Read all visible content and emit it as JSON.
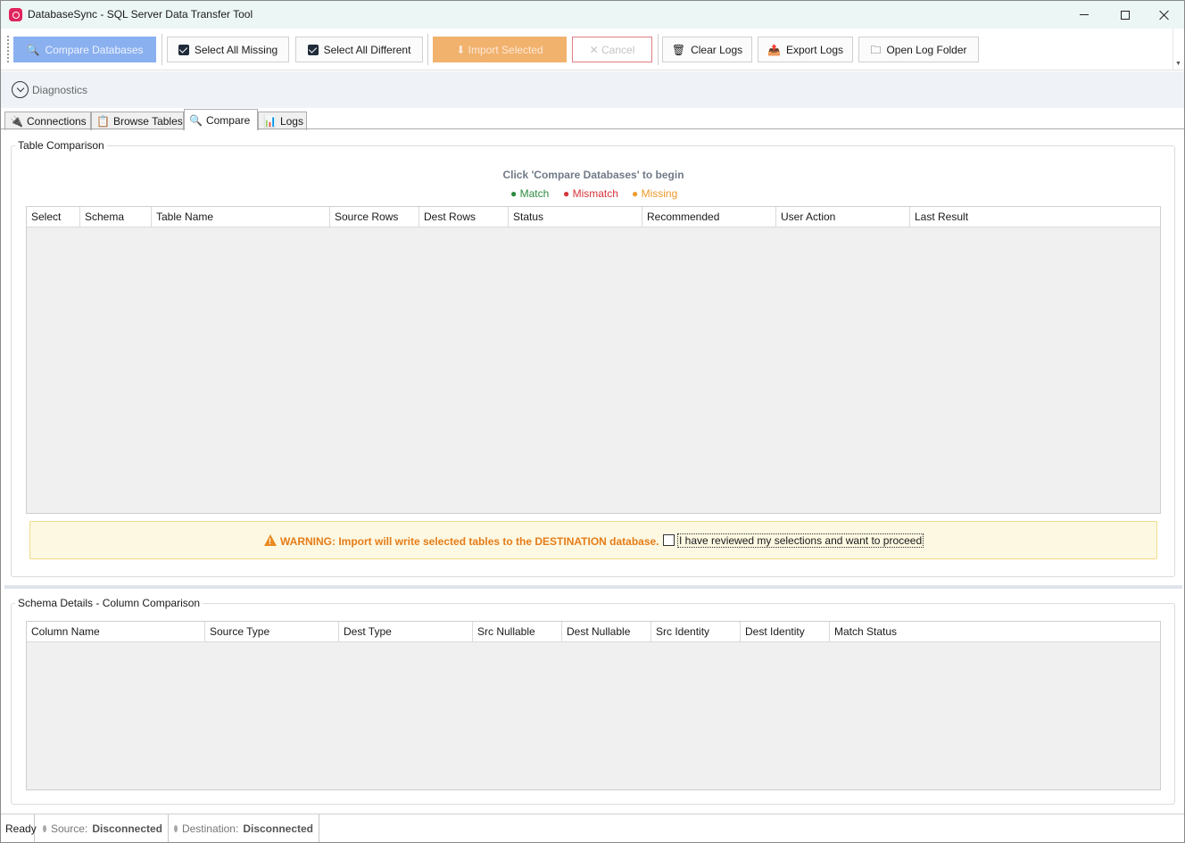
{
  "window": {
    "title": "DatabaseSync - SQL Server Data Transfer Tool"
  },
  "toolbar": {
    "compare_label": "Compare Databases",
    "select_missing_label": "Select All Missing",
    "select_different_label": "Select All Different",
    "import_label": "⬇ Import Selected",
    "cancel_label": "✕ Cancel",
    "clear_logs_label": "Clear Logs",
    "export_logs_label": "Export Logs",
    "open_log_folder_label": "Open Log Folder"
  },
  "diagnostics": {
    "label": "Diagnostics"
  },
  "tabs": [
    {
      "label": "Connections",
      "icon": "plug-icon"
    },
    {
      "label": "Browse Tables",
      "icon": "table-icon"
    },
    {
      "label": "Compare",
      "icon": "magnifier-icon",
      "active": true
    },
    {
      "label": "Logs",
      "icon": "chart-icon"
    }
  ],
  "table_comparison": {
    "title": "Table Comparison",
    "hint": "Click 'Compare Databases' to begin",
    "legend": {
      "match": "● Match",
      "mismatch": "● Mismatch",
      "missing": "● Missing"
    },
    "legend_colors": {
      "match": "#2e8b3e",
      "mismatch": "#d6343b",
      "missing": "#ee9a2c"
    },
    "columns": [
      "Select",
      "Schema",
      "Table Name",
      "Source Rows",
      "Dest Rows",
      "Status",
      "Recommended",
      "User Action",
      "Last Result"
    ],
    "rows": []
  },
  "warning": {
    "text": "WARNING: Import will write selected tables to the DESTINATION database.",
    "confirm_label": "I have reviewed my selections and want to proceed",
    "confirm_checked": false
  },
  "schema_details": {
    "title": "Schema Details - Column Comparison",
    "columns": [
      "Column Name",
      "Source Type",
      "Dest Type",
      "Src Nullable",
      "Dest Nullable",
      "Src Identity",
      "Dest Identity",
      "Match Status"
    ],
    "rows": []
  },
  "status": {
    "ready": "Ready",
    "source_label": "Source:",
    "source_value": "Disconnected",
    "dest_label": "Destination:",
    "dest_value": "Disconnected"
  }
}
